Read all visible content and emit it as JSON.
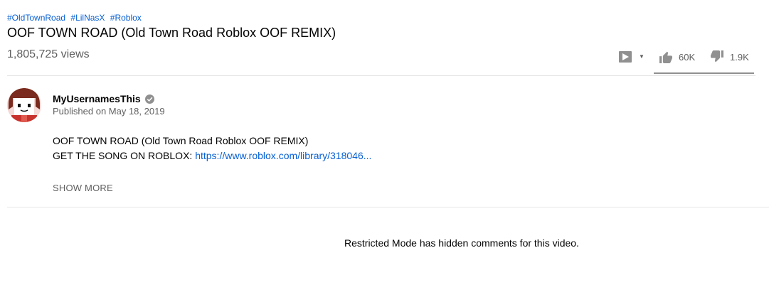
{
  "hashtags": [
    "#OldTownRoad",
    "#LilNasX",
    "#Roblox"
  ],
  "video": {
    "title": "OOF TOWN ROAD (Old Town Road Roblox OOF REMIX)",
    "views": "1,805,725 views"
  },
  "actions": {
    "likes": "60K",
    "dislikes": "1.9K",
    "like_ratio": 0.97
  },
  "channel": {
    "name": "MyUsernamesThis",
    "published": "Published on May 18, 2019"
  },
  "description": {
    "line1": "OOF TOWN ROAD (Old Town Road Roblox OOF REMIX)",
    "line2_prefix": "GET THE SONG ON ROBLOX: ",
    "link": "https://www.roblox.com/library/318046..."
  },
  "show_more": "SHOW MORE",
  "comments_notice": "Restricted Mode has hidden comments for this video.",
  "colors": {
    "link": "#065fd4",
    "secondary_text": "#606060",
    "icon": "#909090"
  },
  "icons": [
    "add-to-playlist-icon",
    "chevron-down-icon",
    "thumbs-up-icon",
    "thumbs-down-icon",
    "verified-icon"
  ]
}
